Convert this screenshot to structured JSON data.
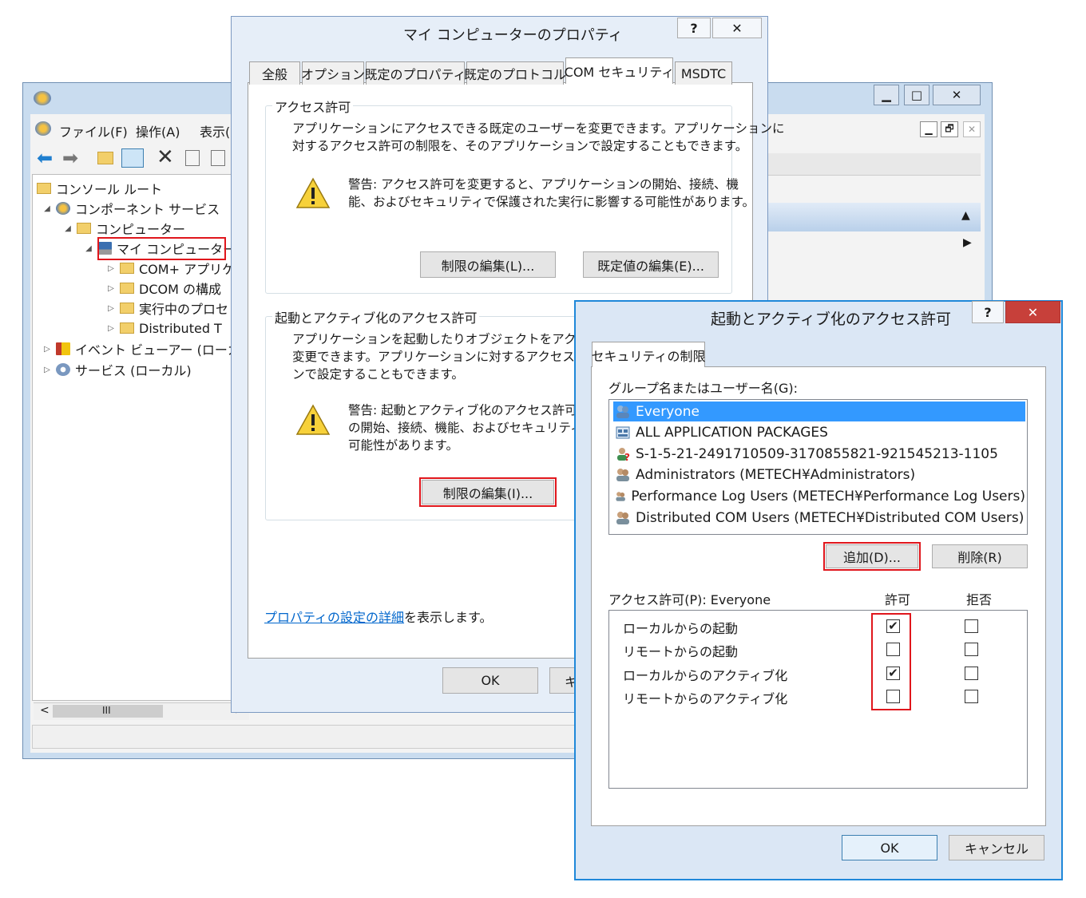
{
  "mmc": {
    "menu": [
      "ファイル(F)",
      "操作(A)",
      "表示("
    ],
    "window_controls": [
      "▁",
      "□",
      "✕"
    ],
    "sub_controls": [
      "▁",
      "🗗",
      "✕"
    ],
    "tree": [
      {
        "label": "コンソール ルート"
      },
      {
        "label": "コンポーネント サービス"
      },
      {
        "label": "コンピューター"
      },
      {
        "label": "マイ コンピューター"
      },
      {
        "label": "COM+ アプリケ"
      },
      {
        "label": "DCOM の構成"
      },
      {
        "label": "実行中のプロセ"
      },
      {
        "label": "Distributed T"
      },
      {
        "label": "イベント ビューアー (ローカル"
      },
      {
        "label": "サービス (ローカル)"
      }
    ],
    "scroll_thumb": "III",
    "scroll_left": "<",
    "scroll_right": ">"
  },
  "props": {
    "title": "マイ コンピューターのプロパティ",
    "help": "?",
    "close": "✕",
    "tabs": [
      "全般",
      "オプション",
      "既定のプロパティ",
      "既定のプロトコル",
      "COM セキュリティ",
      "MSDTC"
    ],
    "access": {
      "group_label": "アクセス許可",
      "desc1": "アプリケーションにアクセスできる既定のユーザーを変更できます。アプリケーションに",
      "desc2": "対するアクセス許可の制限を、そのアプリケーションで設定することもできます。",
      "warn1": "警告: アクセス許可を変更すると、アプリケーションの開始、接続、機",
      "warn2": "能、およびセキュリティで保護された実行に影響する可能性があります。",
      "edit_limits": "制限の編集(L)...",
      "edit_default": "既定値の編集(E)..."
    },
    "launch": {
      "group_label": "起動とアクティブ化のアクセス許可",
      "desc1": "アプリケーションを起動したりオブジェクトをアクティブにし",
      "desc2": "変更できます。アプリケーションに対するアクセス許可の",
      "desc3": "ンで設定することもできます。",
      "warn1": "警告: 起動とアクティブ化のアクセス許可を変",
      "warn2": "の開始、接続、機能、およびセキュリティで保",
      "warn3": "可能性があります。",
      "edit_limits": "制限の編集(I)..."
    },
    "link_text": "プロパティの設定の詳細",
    "link_suffix": "を表示します。",
    "ok": "OK",
    "cancel_partial": "キ"
  },
  "launch_dialog": {
    "title": "起動とアクティブ化のアクセス許可",
    "help": "?",
    "close": "✕",
    "tab": "セキュリティの制限",
    "users_label": "グループ名またはユーザー名(G):",
    "users": [
      {
        "name": "Everyone",
        "icon": "group-icon",
        "selected": true
      },
      {
        "name": "ALL APPLICATION PACKAGES",
        "icon": "packages-icon",
        "selected": false
      },
      {
        "name": "S-1-5-21-2491710509-3170855821-921545213-1105",
        "icon": "unknown-user-icon",
        "selected": false
      },
      {
        "name": "Administrators (METECH¥Administrators)",
        "icon": "group-icon",
        "selected": false
      },
      {
        "name": "Performance Log Users (METECH¥Performance Log Users)",
        "icon": "group-icon",
        "selected": false
      },
      {
        "name": "Distributed COM Users (METECH¥Distributed COM Users)",
        "icon": "group-icon",
        "selected": false
      }
    ],
    "add": "追加(D)...",
    "remove": "削除(R)",
    "perm_label": "アクセス許可(P): Everyone",
    "allow_header": "許可",
    "deny_header": "拒否",
    "permissions": [
      {
        "name": "ローカルからの起動",
        "allow": true,
        "deny": false
      },
      {
        "name": "リモートからの起動",
        "allow": false,
        "deny": false
      },
      {
        "name": "ローカルからのアクティブ化",
        "allow": true,
        "deny": false
      },
      {
        "name": "リモートからのアクティブ化",
        "allow": false,
        "deny": false
      }
    ],
    "ok": "OK",
    "cancel": "キャンセル"
  },
  "colors": {
    "highlight_red": "#e0161c",
    "selection_blue": "#3399ff",
    "link_blue": "#0066cc"
  }
}
